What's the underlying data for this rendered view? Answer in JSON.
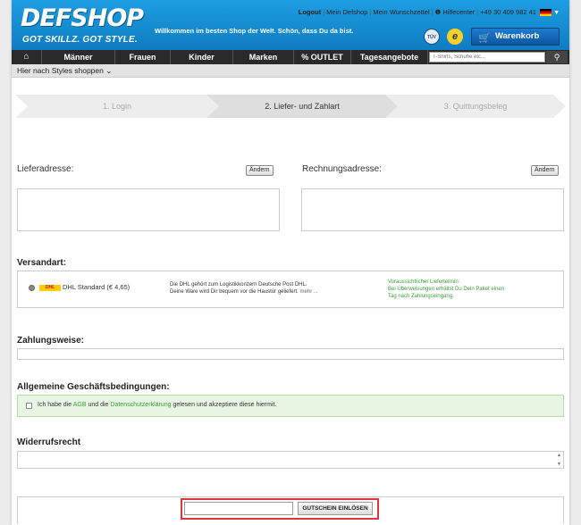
{
  "header": {
    "logo_main": "DEFSHOP",
    "logo_sub": "GOT SKILLZ. GOT STYLE.",
    "welcome": "Willkommen im besten Shop der Welt. Schön, dass Du da bist.",
    "toplinks": {
      "logout": "Logout",
      "my_defshop": "Mein Defshop",
      "wishlist": "Mein Wunschzettel",
      "help": "❶ Hilfecenter",
      "phone": "+49 30 409 982 41"
    },
    "badge_tuv": "TÜV",
    "badge_e": "e",
    "cart_label": "Warenkorb"
  },
  "nav": {
    "items": [
      "Männer",
      "Frauen",
      "Kinder",
      "Marken",
      "% OUTLET",
      "Tagesangebote"
    ],
    "search_placeholder": "T-Shirts, Schuhe etc...",
    "subnav": "Hier nach Styles shoppen ⌄"
  },
  "steps": [
    {
      "label": "1. Login",
      "active": false
    },
    {
      "label": "2. Liefer- und Zahlart",
      "active": true
    },
    {
      "label": "3. Quittungsbeleg",
      "active": false
    }
  ],
  "addresses": {
    "delivery_label": "Lieferadresse:",
    "billing_label": "Rechnungsadresse:",
    "change_label": "Ändern"
  },
  "shipping": {
    "title": "Versandart:",
    "logo": "DHL",
    "name": "DHL Standard (€ 4,65)",
    "desc_line1": "Die DHL gehört zum Logistikkonzern Deutsche Post DHL.",
    "desc_line2": "Deine Ware wird Dir bequem vor die Haustür geliefert.",
    "more": "mehr ...",
    "delivery_line1": "Voraussichtlicher Liefertermin:",
    "delivery_line2": "Bei Überweisungen erhältst Du Dein Paket einen",
    "delivery_line3": "Tag nach Zahlungseingang."
  },
  "payment": {
    "title": "Zahlungsweise:"
  },
  "terms": {
    "title": "Allgemeine Geschäftsbedingungen:",
    "text_a": "Ich habe die",
    "agb": "AGB",
    "text_b": "und die",
    "privacy": "Datenschutzerklärung",
    "text_c": "gelesen und akzeptiere diese hiermit."
  },
  "withdrawal": {
    "title": "Widerrufsrecht"
  },
  "voucher": {
    "button": "GUTSCHEIN EINLÖSEN",
    "value": ""
  },
  "colors": {
    "header_blue": "#1d9ee2",
    "nav_dark": "#2a2a2a",
    "green": "#3aa03a",
    "highlight_red": "#d9363e"
  }
}
